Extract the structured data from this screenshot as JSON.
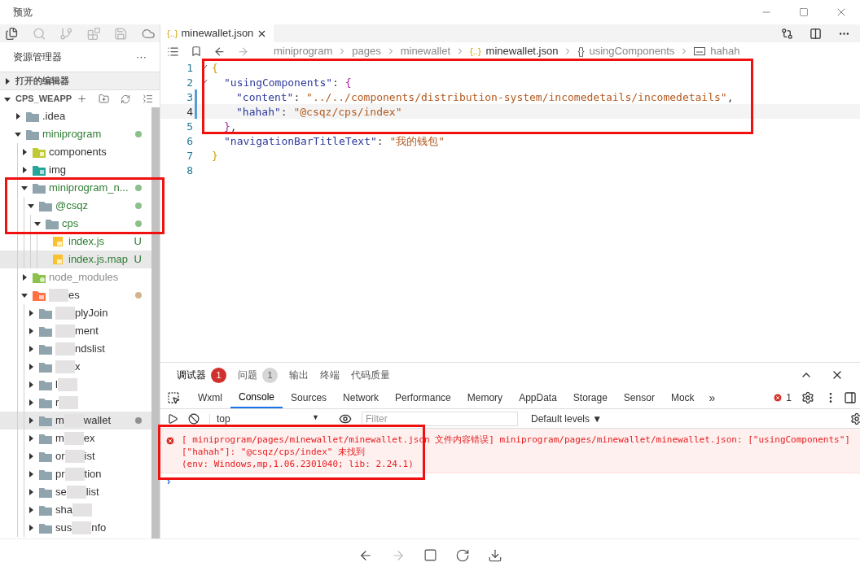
{
  "window": {
    "title": "预览"
  },
  "sidebar": {
    "title": "资源管理器",
    "more": "···",
    "open_editors": {
      "label": "打开的编辑器",
      "expanded": false
    },
    "project": {
      "label": "CPS_WEAPP",
      "expanded": true
    },
    "tree": [
      {
        "kind": "folder",
        "start": ".idea",
        "expanded": false,
        "selected": false
      },
      {
        "kind": "folder",
        "start": "miniprogram",
        "color": "#2e7d32",
        "expanded": true,
        "selected": false,
        "badge": {
          "kind": "dot",
          "color": "#8cc08c"
        },
        "children": [
          {
            "kind": "components",
            "start": "components",
            "expanded": false,
            "selected": false
          },
          {
            "kind": "img",
            "start": "img",
            "expanded": false,
            "selected": false
          },
          {
            "kind": "folder",
            "start": "miniprogram_n...",
            "color": "#2e7d32",
            "expanded": true,
            "selected": false,
            "badge": {
              "kind": "dot",
              "color": "#8cc08c"
            },
            "children": [
              {
                "kind": "folder",
                "start": "@csqz",
                "color": "#2e7d32",
                "expanded": true,
                "selected": false,
                "badge": {
                  "kind": "dot",
                  "color": "#8cc08c"
                },
                "children": [
                  {
                    "kind": "folder",
                    "start": "cps",
                    "color": "#2e7d32",
                    "expanded": true,
                    "selected": false,
                    "badge": {
                      "kind": "dot",
                      "color": "#8cc08c"
                    },
                    "children": [
                      {
                        "kind": "js",
                        "start": "index.js",
                        "color": "#2e7d32",
                        "selected": false,
                        "badge": {
                          "kind": "letter",
                          "text": "U"
                        }
                      },
                      {
                        "kind": "js",
                        "start": "index.js.map",
                        "color": "#2e7d32",
                        "selected": true,
                        "badge": {
                          "kind": "letter",
                          "text": "U"
                        }
                      }
                    ]
                  }
                ]
              }
            ]
          },
          {
            "kind": "node",
            "start": "node_modules",
            "color": "#8c8c8c",
            "expanded": false,
            "selected": false
          },
          {
            "kind": "pages",
            "end": "es",
            "redacted": true,
            "expanded": true,
            "selected": false,
            "badge": {
              "kind": "dot",
              "color": "#d2b48c"
            },
            "children": [
              {
                "kind": "folder",
                "end": "plyJoin",
                "redacted": true,
                "expanded": false,
                "selected": false
              },
              {
                "kind": "folder",
                "end": "ment",
                "redacted": true,
                "expanded": false,
                "selected": false
              },
              {
                "kind": "folder",
                "end": "ndslist",
                "redacted": true,
                "expanded": false,
                "selected": false
              },
              {
                "kind": "folder",
                "end": "x",
                "redacted": true,
                "expanded": false,
                "selected": false
              },
              {
                "kind": "folder",
                "start": "l",
                "redacted": true,
                "expanded": false,
                "selected": false
              },
              {
                "kind": "folder",
                "start": "r",
                "redacted": true,
                "expanded": false,
                "selected": false
              },
              {
                "kind": "folder",
                "start": "m",
                "end": "wallet",
                "redacted": true,
                "expanded": false,
                "selected": true,
                "badge": {
                  "kind": "dot",
                  "color": "#909090"
                }
              },
              {
                "kind": "folder",
                "start": "m",
                "end": "ex",
                "redacted": true,
                "expanded": false,
                "selected": false
              },
              {
                "kind": "folder",
                "start": "or",
                "end": "ist",
                "redacted": true,
                "expanded": false,
                "selected": false
              },
              {
                "kind": "folder",
                "start": "pr",
                "end": "tion",
                "redacted": true,
                "expanded": false,
                "selected": false
              },
              {
                "kind": "folder",
                "start": "se",
                "end": "list",
                "redacted": true,
                "expanded": false,
                "selected": false
              },
              {
                "kind": "folder",
                "start": "sha",
                "redacted": true,
                "expanded": false,
                "selected": false
              },
              {
                "kind": "folder",
                "start": "sus",
                "end": "nfo",
                "redacted": true,
                "expanded": false,
                "selected": false
              }
            ]
          }
        ]
      }
    ]
  },
  "editor": {
    "tab": {
      "glyph": "{..}",
      "label": "minewallet.json",
      "selected": true
    },
    "breadcrumb": [
      {
        "text": "miniprogram"
      },
      {
        "text": "pages"
      },
      {
        "text": "minewallet"
      },
      {
        "kind": "json",
        "glyph": "{..}",
        "text": "minewallet.json"
      },
      {
        "kind": "object",
        "glyph": "{}",
        "text": "usingComponents"
      },
      {
        "kind": "string",
        "text": "hahah"
      }
    ],
    "lines": [
      {
        "number": "1",
        "kind": "outer",
        "fold": true,
        "changed": false,
        "current": false,
        "tokens": [
          {
            "kind": "brace",
            "text": "{"
          }
        ]
      },
      {
        "number": "2",
        "kind": "member",
        "fold": true,
        "changed": false,
        "current": false,
        "tokens": [
          {
            "kind": "key",
            "text": "\"usingComponents\""
          },
          {
            "kind": "punct",
            "text": ": "
          },
          {
            "kind": "bracket",
            "text": "{"
          }
        ]
      },
      {
        "number": "3",
        "kind": "nested",
        "fold": false,
        "changed": true,
        "current": false,
        "tokens": [
          {
            "kind": "key",
            "text": "\"content\""
          },
          {
            "kind": "punct",
            "text": ": "
          },
          {
            "kind": "string",
            "text": "\"../../components/distribution-system/incomedetails/incomedetails\""
          },
          {
            "kind": "punct",
            "text": ","
          }
        ]
      },
      {
        "number": "4",
        "kind": "nested",
        "fold": false,
        "changed": true,
        "current": true,
        "tokens": [
          {
            "kind": "key",
            "text": "\"hahah\""
          },
          {
            "kind": "punct",
            "text": ": "
          },
          {
            "kind": "string",
            "text": "\"@csqz/cps/index\""
          }
        ]
      },
      {
        "number": "5",
        "kind": "member",
        "fold": false,
        "changed": false,
        "current": false,
        "tokens": [
          {
            "kind": "bracket",
            "text": "}"
          },
          {
            "kind": "punct",
            "text": ","
          }
        ]
      },
      {
        "number": "6",
        "kind": "member",
        "fold": false,
        "changed": false,
        "current": false,
        "tokens": [
          {
            "kind": "key",
            "text": "\"navigationBarTitleText\""
          },
          {
            "kind": "punct",
            "text": ": "
          },
          {
            "kind": "string",
            "text": "\"我的钱包\""
          }
        ]
      },
      {
        "number": "7",
        "kind": "outer",
        "fold": false,
        "changed": false,
        "current": false,
        "tokens": [
          {
            "kind": "brace",
            "text": "}"
          }
        ]
      },
      {
        "number": "8",
        "kind": "outer",
        "fold": false,
        "changed": false,
        "current": false
      }
    ]
  },
  "devtools": {
    "panel_tabs": [
      {
        "label": "调试器",
        "count": "1",
        "kind": "error",
        "selected": true
      },
      {
        "label": "问题",
        "count": "1",
        "kind": "neutral",
        "selected": false
      },
      {
        "label": "输出",
        "selected": false
      },
      {
        "label": "终端",
        "selected": false
      },
      {
        "label": "代码质量",
        "selected": false
      }
    ],
    "tools": [
      {
        "label": "Wxml",
        "selected": false
      },
      {
        "label": "Console",
        "selected": true
      },
      {
        "label": "Sources",
        "selected": false
      },
      {
        "label": "Network",
        "selected": false
      },
      {
        "label": "Performance",
        "selected": false
      },
      {
        "label": "Memory",
        "selected": false
      },
      {
        "label": "AppData",
        "selected": false
      },
      {
        "label": "Storage",
        "selected": false
      },
      {
        "label": "Sensor",
        "selected": false
      },
      {
        "label": "Mock",
        "selected": false
      }
    ],
    "more": "»",
    "error_count": "1",
    "context": "top",
    "context_caret": "▼",
    "filter": {
      "placeholder": "Filter"
    },
    "levels": "Default levels ▼",
    "messages": [
      {
        "kind": "error",
        "lines": [
          "[ miniprogram/pages/minewallet/minewallet.json 文件内容错误] miniprogram/pages/minewallet/minewallet.json: [\"usingComponents\"]",
          "[\"hahah\"]: \"@csqz/cps/index\" 未找到",
          "(env: Windows,mp,1.06.2301040; lib: 2.24.1)"
        ]
      }
    ],
    "prompt": "›"
  }
}
